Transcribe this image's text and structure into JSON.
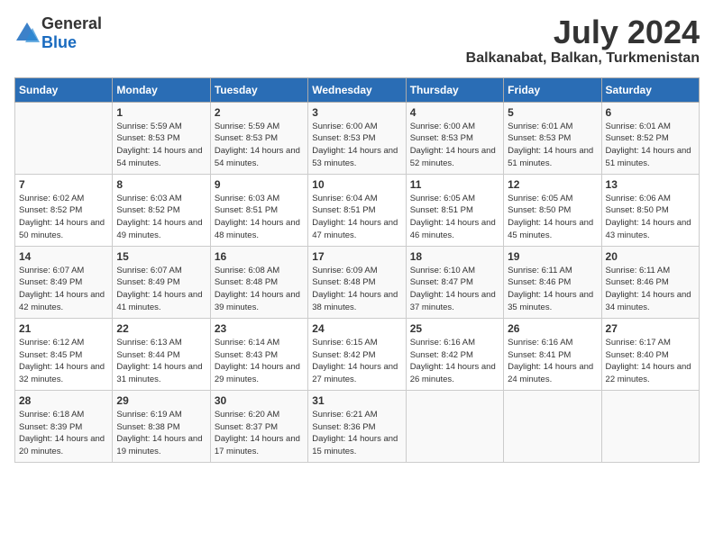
{
  "logo": {
    "general": "General",
    "blue": "Blue"
  },
  "title": {
    "month_year": "July 2024",
    "location": "Balkanabat, Balkan, Turkmenistan"
  },
  "header_days": [
    "Sunday",
    "Monday",
    "Tuesday",
    "Wednesday",
    "Thursday",
    "Friday",
    "Saturday"
  ],
  "weeks": [
    [
      {
        "day": "",
        "sunrise": "",
        "sunset": "",
        "daylight": ""
      },
      {
        "day": "1",
        "sunrise": "Sunrise: 5:59 AM",
        "sunset": "Sunset: 8:53 PM",
        "daylight": "Daylight: 14 hours and 54 minutes."
      },
      {
        "day": "2",
        "sunrise": "Sunrise: 5:59 AM",
        "sunset": "Sunset: 8:53 PM",
        "daylight": "Daylight: 14 hours and 54 minutes."
      },
      {
        "day": "3",
        "sunrise": "Sunrise: 6:00 AM",
        "sunset": "Sunset: 8:53 PM",
        "daylight": "Daylight: 14 hours and 53 minutes."
      },
      {
        "day": "4",
        "sunrise": "Sunrise: 6:00 AM",
        "sunset": "Sunset: 8:53 PM",
        "daylight": "Daylight: 14 hours and 52 minutes."
      },
      {
        "day": "5",
        "sunrise": "Sunrise: 6:01 AM",
        "sunset": "Sunset: 8:53 PM",
        "daylight": "Daylight: 14 hours and 51 minutes."
      },
      {
        "day": "6",
        "sunrise": "Sunrise: 6:01 AM",
        "sunset": "Sunset: 8:52 PM",
        "daylight": "Daylight: 14 hours and 51 minutes."
      }
    ],
    [
      {
        "day": "7",
        "sunrise": "Sunrise: 6:02 AM",
        "sunset": "Sunset: 8:52 PM",
        "daylight": "Daylight: 14 hours and 50 minutes."
      },
      {
        "day": "8",
        "sunrise": "Sunrise: 6:03 AM",
        "sunset": "Sunset: 8:52 PM",
        "daylight": "Daylight: 14 hours and 49 minutes."
      },
      {
        "day": "9",
        "sunrise": "Sunrise: 6:03 AM",
        "sunset": "Sunset: 8:51 PM",
        "daylight": "Daylight: 14 hours and 48 minutes."
      },
      {
        "day": "10",
        "sunrise": "Sunrise: 6:04 AM",
        "sunset": "Sunset: 8:51 PM",
        "daylight": "Daylight: 14 hours and 47 minutes."
      },
      {
        "day": "11",
        "sunrise": "Sunrise: 6:05 AM",
        "sunset": "Sunset: 8:51 PM",
        "daylight": "Daylight: 14 hours and 46 minutes."
      },
      {
        "day": "12",
        "sunrise": "Sunrise: 6:05 AM",
        "sunset": "Sunset: 8:50 PM",
        "daylight": "Daylight: 14 hours and 45 minutes."
      },
      {
        "day": "13",
        "sunrise": "Sunrise: 6:06 AM",
        "sunset": "Sunset: 8:50 PM",
        "daylight": "Daylight: 14 hours and 43 minutes."
      }
    ],
    [
      {
        "day": "14",
        "sunrise": "Sunrise: 6:07 AM",
        "sunset": "Sunset: 8:49 PM",
        "daylight": "Daylight: 14 hours and 42 minutes."
      },
      {
        "day": "15",
        "sunrise": "Sunrise: 6:07 AM",
        "sunset": "Sunset: 8:49 PM",
        "daylight": "Daylight: 14 hours and 41 minutes."
      },
      {
        "day": "16",
        "sunrise": "Sunrise: 6:08 AM",
        "sunset": "Sunset: 8:48 PM",
        "daylight": "Daylight: 14 hours and 39 minutes."
      },
      {
        "day": "17",
        "sunrise": "Sunrise: 6:09 AM",
        "sunset": "Sunset: 8:48 PM",
        "daylight": "Daylight: 14 hours and 38 minutes."
      },
      {
        "day": "18",
        "sunrise": "Sunrise: 6:10 AM",
        "sunset": "Sunset: 8:47 PM",
        "daylight": "Daylight: 14 hours and 37 minutes."
      },
      {
        "day": "19",
        "sunrise": "Sunrise: 6:11 AM",
        "sunset": "Sunset: 8:46 PM",
        "daylight": "Daylight: 14 hours and 35 minutes."
      },
      {
        "day": "20",
        "sunrise": "Sunrise: 6:11 AM",
        "sunset": "Sunset: 8:46 PM",
        "daylight": "Daylight: 14 hours and 34 minutes."
      }
    ],
    [
      {
        "day": "21",
        "sunrise": "Sunrise: 6:12 AM",
        "sunset": "Sunset: 8:45 PM",
        "daylight": "Daylight: 14 hours and 32 minutes."
      },
      {
        "day": "22",
        "sunrise": "Sunrise: 6:13 AM",
        "sunset": "Sunset: 8:44 PM",
        "daylight": "Daylight: 14 hours and 31 minutes."
      },
      {
        "day": "23",
        "sunrise": "Sunrise: 6:14 AM",
        "sunset": "Sunset: 8:43 PM",
        "daylight": "Daylight: 14 hours and 29 minutes."
      },
      {
        "day": "24",
        "sunrise": "Sunrise: 6:15 AM",
        "sunset": "Sunset: 8:42 PM",
        "daylight": "Daylight: 14 hours and 27 minutes."
      },
      {
        "day": "25",
        "sunrise": "Sunrise: 6:16 AM",
        "sunset": "Sunset: 8:42 PM",
        "daylight": "Daylight: 14 hours and 26 minutes."
      },
      {
        "day": "26",
        "sunrise": "Sunrise: 6:16 AM",
        "sunset": "Sunset: 8:41 PM",
        "daylight": "Daylight: 14 hours and 24 minutes."
      },
      {
        "day": "27",
        "sunrise": "Sunrise: 6:17 AM",
        "sunset": "Sunset: 8:40 PM",
        "daylight": "Daylight: 14 hours and 22 minutes."
      }
    ],
    [
      {
        "day": "28",
        "sunrise": "Sunrise: 6:18 AM",
        "sunset": "Sunset: 8:39 PM",
        "daylight": "Daylight: 14 hours and 20 minutes."
      },
      {
        "day": "29",
        "sunrise": "Sunrise: 6:19 AM",
        "sunset": "Sunset: 8:38 PM",
        "daylight": "Daylight: 14 hours and 19 minutes."
      },
      {
        "day": "30",
        "sunrise": "Sunrise: 6:20 AM",
        "sunset": "Sunset: 8:37 PM",
        "daylight": "Daylight: 14 hours and 17 minutes."
      },
      {
        "day": "31",
        "sunrise": "Sunrise: 6:21 AM",
        "sunset": "Sunset: 8:36 PM",
        "daylight": "Daylight: 14 hours and 15 minutes."
      },
      {
        "day": "",
        "sunrise": "",
        "sunset": "",
        "daylight": ""
      },
      {
        "day": "",
        "sunrise": "",
        "sunset": "",
        "daylight": ""
      },
      {
        "day": "",
        "sunrise": "",
        "sunset": "",
        "daylight": ""
      }
    ]
  ]
}
